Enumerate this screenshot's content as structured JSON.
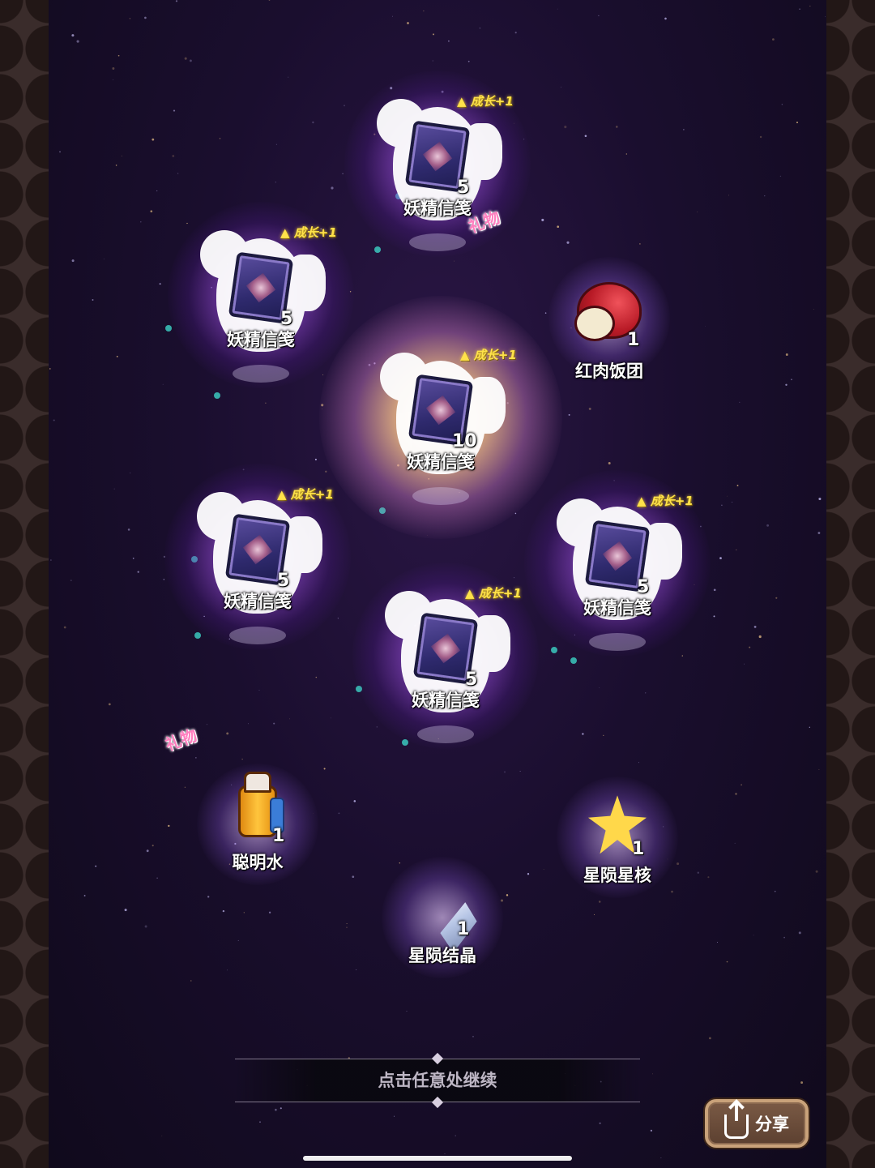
{
  "rewards": [
    {
      "name": "妖精信笺",
      "count": "5",
      "badge": "成长+1",
      "type": "card",
      "pos": "top"
    },
    {
      "name": "妖精信笺",
      "count": "5",
      "badge": "成长+1",
      "type": "card",
      "pos": "upper-left"
    },
    {
      "name": "红肉饭团",
      "count": "1",
      "gift": "礼物",
      "type": "riceball",
      "pos": "upper-right"
    },
    {
      "name": "妖精信笺",
      "count": "10",
      "badge": "成长+1",
      "type": "card",
      "pos": "center",
      "highlight": true
    },
    {
      "name": "妖精信笺",
      "count": "5",
      "badge": "成长+1",
      "type": "card",
      "pos": "lower-left"
    },
    {
      "name": "妖精信笺",
      "count": "5",
      "badge": "成长+1",
      "type": "card",
      "pos": "lower-right"
    },
    {
      "name": "妖精信笺",
      "count": "5",
      "badge": "成长+1",
      "type": "card",
      "pos": "bottom"
    },
    {
      "name": "聪明水",
      "count": "1",
      "gift": "礼物",
      "type": "bottle",
      "pos": "bottom-left"
    },
    {
      "name": "星陨星核",
      "count": "1",
      "type": "starcore",
      "pos": "bottom-right"
    },
    {
      "name": "星陨结晶",
      "count": "1",
      "type": "crystal",
      "pos": "bottom-center"
    }
  ],
  "continue_text": "点击任意处继续",
  "share_label": "分享",
  "colors": {
    "growth_badge": "#ffe24a",
    "gift_badge": "#ff7fbf",
    "glow": "#c78cff",
    "background": "#1a0e2e"
  }
}
